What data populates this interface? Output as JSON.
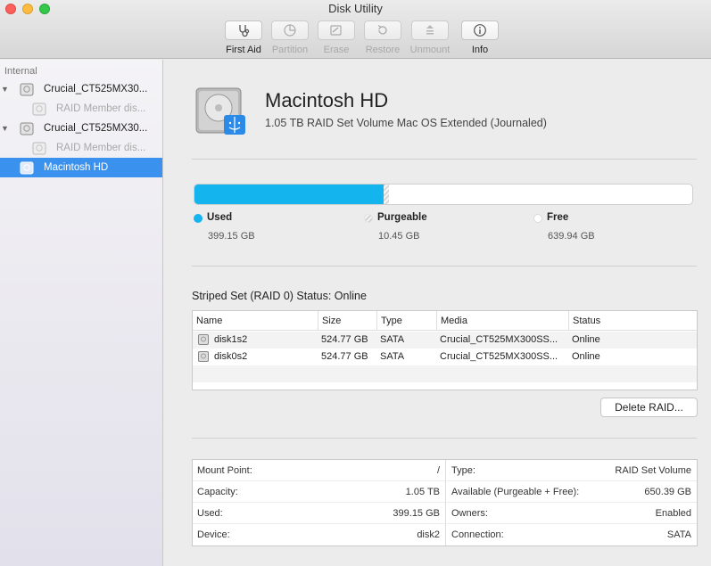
{
  "window": {
    "title": "Disk Utility"
  },
  "toolbar": {
    "items": [
      {
        "label": "First Aid",
        "icon": "stethoscope-icon"
      },
      {
        "label": "Partition",
        "icon": "pie-chart-icon"
      },
      {
        "label": "Erase",
        "icon": "erase-icon"
      },
      {
        "label": "Restore",
        "icon": "restore-icon"
      },
      {
        "label": "Unmount",
        "icon": "eject-icon"
      },
      {
        "label": "Info",
        "icon": "info-icon"
      }
    ]
  },
  "sidebar": {
    "header": "Internal",
    "items": [
      {
        "label": "Crucial_CT525MX30...",
        "icon": "hard-drive-icon"
      },
      {
        "label": "RAID Member dis...",
        "icon": "volume-icon"
      },
      {
        "label": "Crucial_CT525MX30...",
        "icon": "hard-drive-icon"
      },
      {
        "label": "RAID Member dis...",
        "icon": "volume-icon"
      },
      {
        "label": "Macintosh HD",
        "icon": "volume-icon"
      }
    ]
  },
  "volume": {
    "name": "Macintosh HD",
    "description": "1.05 TB RAID Set Volume Mac OS Extended (Journaled)"
  },
  "usage": {
    "used_fraction": 0.38,
    "purgeable_fraction": 0.01,
    "legend": [
      {
        "name": "Used",
        "value": "399.15 GB",
        "color": "#14b4ee"
      },
      {
        "name": "Purgeable",
        "value": "10.45 GB",
        "color": "#d9d9d9"
      },
      {
        "name": "Free",
        "value": "639.94 GB",
        "color": "#ffffff"
      }
    ]
  },
  "raid": {
    "status": "Striped Set (RAID 0) Status: Online",
    "columns": [
      "Name",
      "Size",
      "Type",
      "Media",
      "Status"
    ],
    "rows": [
      [
        "disk1s2",
        "524.77 GB",
        "SATA",
        "Crucial_CT525MX300SS...",
        "Online"
      ],
      [
        "disk0s2",
        "524.77 GB",
        "SATA",
        "Crucial_CT525MX300SS...",
        "Online"
      ]
    ],
    "delete_button": "Delete RAID..."
  },
  "info": {
    "left": [
      {
        "key": "Mount Point:",
        "value": "/"
      },
      {
        "key": "Capacity:",
        "value": "1.05 TB"
      },
      {
        "key": "Used:",
        "value": "399.15 GB"
      },
      {
        "key": "Device:",
        "value": "disk2"
      }
    ],
    "right": [
      {
        "key": "Type:",
        "value": "RAID Set Volume"
      },
      {
        "key": "Available (Purgeable + Free):",
        "value": "650.39 GB"
      },
      {
        "key": "Owners:",
        "value": "Enabled"
      },
      {
        "key": "Connection:",
        "value": "SATA"
      }
    ]
  },
  "colors": {
    "selection": "#3a91ee",
    "used": "#14b4ee"
  }
}
